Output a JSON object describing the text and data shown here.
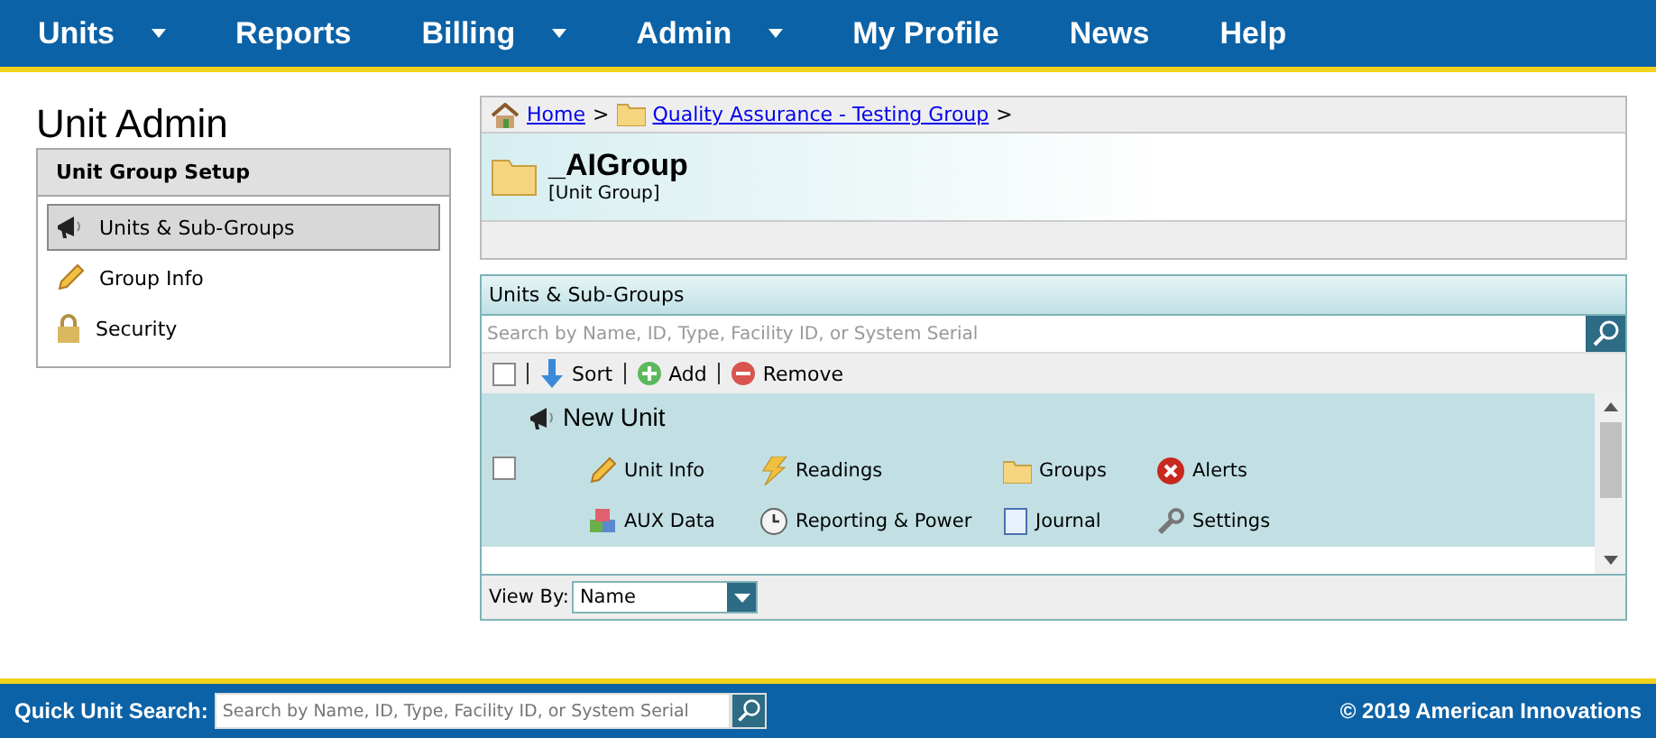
{
  "nav": [
    {
      "label": "Units",
      "dropdown": true
    },
    {
      "label": "Reports",
      "dropdown": false
    },
    {
      "label": "Billing",
      "dropdown": true
    },
    {
      "label": "Admin",
      "dropdown": true
    },
    {
      "label": "My Profile",
      "dropdown": false
    },
    {
      "label": "News",
      "dropdown": false
    },
    {
      "label": "Help",
      "dropdown": false
    }
  ],
  "page_title": "Unit Admin",
  "sidebar": {
    "heading": "Unit Group Setup",
    "items": [
      {
        "label": "Units & Sub-Groups",
        "selected": true
      },
      {
        "label": "Group Info",
        "selected": false
      },
      {
        "label": "Security",
        "selected": false
      }
    ]
  },
  "breadcrumb": [
    {
      "label": "Home"
    },
    {
      "label": "Quality Assurance - Testing Group"
    }
  ],
  "breadcrumb_sep": ">",
  "group": {
    "name": "_AIGroup",
    "type": "[Unit Group]"
  },
  "units_panel": {
    "title": "Units & Sub-Groups",
    "search_placeholder": "Search by Name, ID, Type, Facility ID, or System Serial",
    "toolbar": [
      "Sort",
      "Add",
      "Remove"
    ],
    "select_all_checked": false,
    "units": [
      {
        "name": "New Unit",
        "checked": false,
        "actions": [
          "Unit Info",
          "Readings",
          "Groups",
          "Alerts",
          "AUX Data",
          "Reporting & Power",
          "Journal",
          "Settings"
        ]
      }
    ],
    "view_by_label": "View By:",
    "view_by_value": "Name"
  },
  "footer": {
    "search_label": "Quick Unit Search:",
    "search_placeholder": "Search by Name, ID, Type, Facility ID, or System Serial",
    "copyright": "© 2019 American Innovations"
  }
}
